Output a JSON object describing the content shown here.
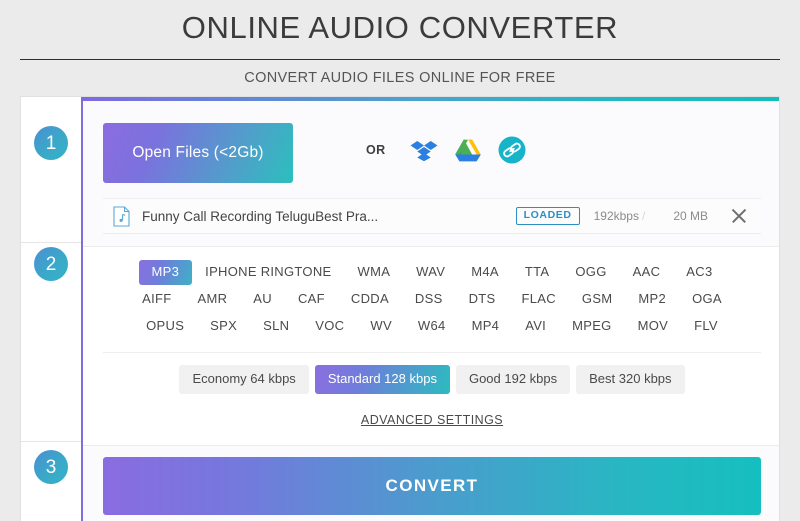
{
  "header": {
    "title": "ONLINE AUDIO CONVERTER",
    "subtitle": "CONVERT AUDIO FILES ONLINE FOR FREE"
  },
  "steps": {
    "one": "1",
    "two": "2",
    "three": "3"
  },
  "step1": {
    "open_files_label": "Open Files (<2Gb)",
    "or_label": "OR",
    "cloud_sources": [
      {
        "name": "dropbox-icon",
        "label": "Dropbox"
      },
      {
        "name": "google-drive-icon",
        "label": "Google Drive"
      },
      {
        "name": "url-link-icon",
        "label": "Link"
      }
    ],
    "file": {
      "name": "Funny Call Recording TeluguBest Pra...",
      "status": "LOADED",
      "bitrate": "192kbps",
      "separator": "/",
      "size": "20 MB"
    }
  },
  "step2": {
    "format_rows": [
      [
        "MP3",
        "IPHONE RINGTONE",
        "WMA",
        "WAV",
        "M4A",
        "TTA",
        "OGG",
        "AAC",
        "AC3"
      ],
      [
        "AIFF",
        "AMR",
        "AU",
        "CAF",
        "CDDA",
        "DSS",
        "DTS",
        "FLAC",
        "GSM",
        "MP2",
        "OGA"
      ],
      [
        "OPUS",
        "SPX",
        "SLN",
        "VOC",
        "WV",
        "W64",
        "MP4",
        "AVI",
        "MPEG",
        "MOV",
        "FLV"
      ]
    ],
    "selected_format": "MP3",
    "quality_presets": [
      "Economy 64 kbps",
      "Standard 128 kbps",
      "Good 192 kbps",
      "Best 320 kbps"
    ],
    "selected_quality": "Standard 128 kbps",
    "advanced_settings_label": "ADVANCED SETTINGS"
  },
  "step3": {
    "convert_label": "CONVERT"
  },
  "colors": {
    "gradient_start": "#8a6ce1",
    "gradient_end": "#15bfbf",
    "accent_purple": "#7f6fdd",
    "accent_teal": "#14bdbb",
    "badge_blue": "#2b8fc4",
    "page_bg": "#ebebeb"
  }
}
